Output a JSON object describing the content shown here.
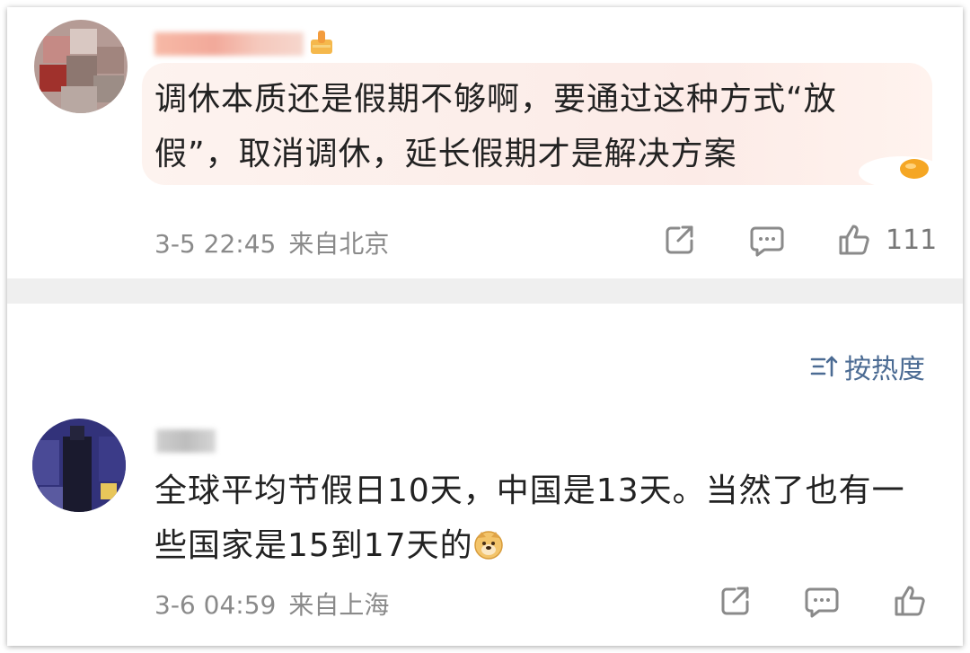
{
  "comments": [
    {
      "text_line1": "调休本质还是假期不够啊，要通过这种方式“放",
      "text_line2": "假”，取消调休，延长假期才是解决方案",
      "time": "3-5 22:45",
      "location": "来自北京",
      "likes": "111"
    },
    {
      "text_line1": "全球平均节假日10天，中国是13天。当然了也有一",
      "text_line2": "些国家是15到17天的",
      "time": "3-6 04:59",
      "location": "来自上海",
      "likes": ""
    }
  ],
  "sort": {
    "label": "按热度"
  },
  "icons": {
    "share": "share-icon",
    "comment": "comment-icon",
    "like": "thumbs-up-icon",
    "sort": "sort-icon",
    "emoji": "doge-emoji-icon"
  },
  "colors": {
    "text": "#222222",
    "meta": "#8a8a8a",
    "sort_link": "#4b6b93",
    "bubble": "#fcebe7"
  }
}
